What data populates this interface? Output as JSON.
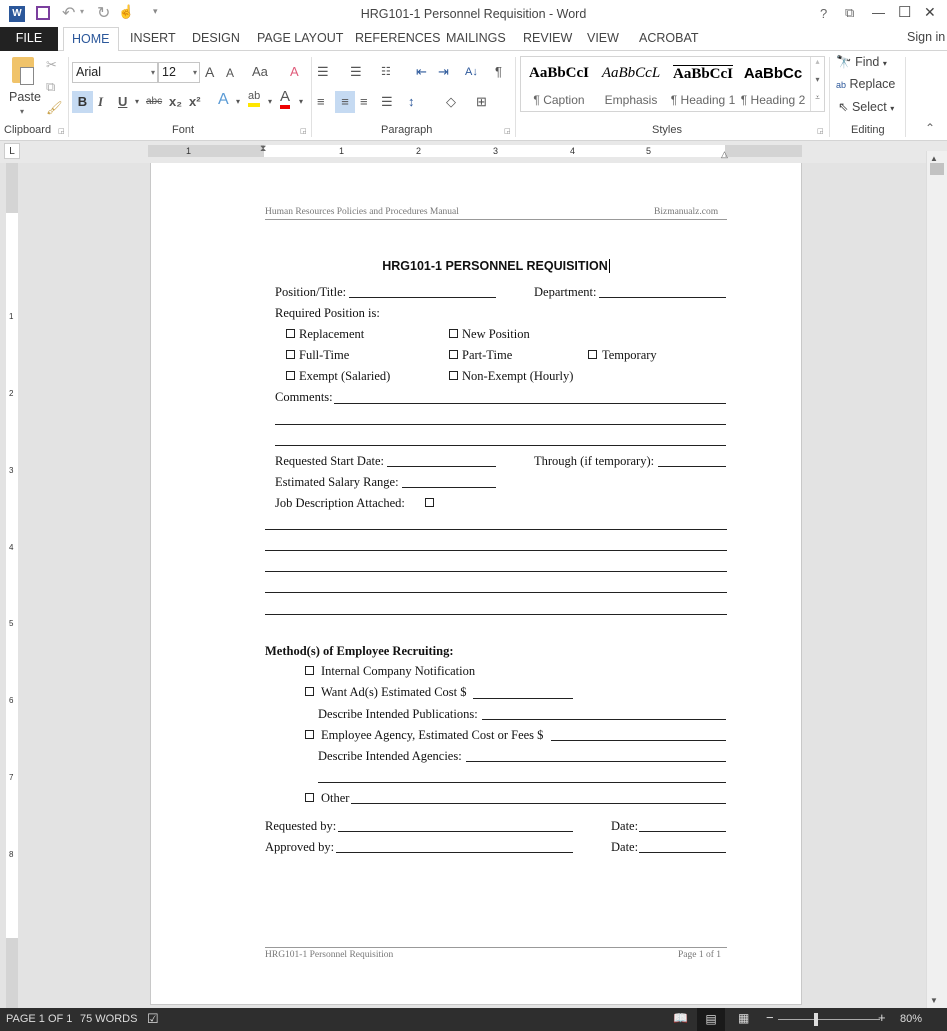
{
  "titlebar": {
    "title": "HRG101-1 Personnel Requisition - Word",
    "help": "?",
    "ribbon_display": "⧉",
    "minimize": "—",
    "maximize": "☐",
    "close": "✕"
  },
  "quick_access": {
    "word_logo": "W",
    "save": "💾",
    "undo": "↶",
    "redo": "↻",
    "touch": "☝",
    "customize": "▾"
  },
  "tabs": [
    "FILE",
    "HOME",
    "INSERT",
    "DESIGN",
    "PAGE LAYOUT",
    "REFERENCES",
    "MAILINGS",
    "REVIEW",
    "VIEW",
    "ACROBAT"
  ],
  "sign_in": "Sign in",
  "ribbon": {
    "clipboard": {
      "paste": "Paste",
      "label": "Clipboard"
    },
    "font": {
      "name": "Arial",
      "size": "12",
      "grow": "A",
      "shrink": "A",
      "case": "Aa",
      "bold": "B",
      "italic": "I",
      "underline": "U",
      "strike": "abc",
      "subscript": "x₂",
      "superscript": "x²",
      "effects": "A",
      "highlight": "ab",
      "color": "A",
      "label": "Font"
    },
    "paragraph": {
      "label": "Paragraph",
      "sort": "A↓",
      "pilcrow": "¶"
    },
    "styles": {
      "label": "Styles",
      "items": [
        {
          "preview": "AaBbCcI",
          "name": "¶ Caption"
        },
        {
          "preview": "AaBbCcL",
          "name": "Emphasis"
        },
        {
          "preview": "AaBbCcI",
          "name": "¶ Heading 1"
        },
        {
          "preview": "AaBbCc",
          "name": "¶ Heading 2"
        }
      ]
    },
    "editing": {
      "find": "Find",
      "replace": "Replace",
      "select": "Select",
      "label": "Editing"
    }
  },
  "ruler": {
    "h_ticks": [
      "1",
      "1",
      "2",
      "3",
      "4",
      "5"
    ],
    "v_ticks": [
      "1",
      "2",
      "3",
      "4",
      "5",
      "6",
      "7",
      "8"
    ],
    "tab_selector": "L"
  },
  "document": {
    "header_left": "Human Resources Policies and Procedures Manual",
    "header_right": "Bizmanualz.com",
    "title": "HRG101-1 PERSONNEL REQUISITION",
    "position_title": "Position/Title:",
    "department": "Department:",
    "required_position": "Required Position is:",
    "options": [
      "Replacement",
      "New Position",
      "Full-Time",
      "Part-Time",
      "Temporary",
      "Exempt (Salaried)",
      "Non-Exempt (Hourly)"
    ],
    "comments": "Comments:",
    "requested_start": "Requested Start Date:",
    "through": "Through (if temporary):",
    "salary_range": "Estimated Salary Range:",
    "job_desc": "Job Description Attached:",
    "methods_heading": "Method(s) of Employee Recruiting:",
    "internal": "Internal Company Notification",
    "want_ads": "Want Ad(s) Estimated Cost $",
    "publications": "Describe Intended Publications:",
    "agency": "Employee Agency, Estimated Cost or Fees $",
    "agencies": "Describe Intended Agencies:",
    "other": "Other",
    "requested_by": "Requested by:",
    "approved_by": "Approved by:",
    "date": "Date:",
    "footer_left": "HRG101-1 Personnel Requisition",
    "footer_right": "Page 1 of 1"
  },
  "statusbar": {
    "page": "PAGE 1 OF 1",
    "words": "75 WORDS",
    "zoom": "80%",
    "zoom_level_percent": 80
  }
}
